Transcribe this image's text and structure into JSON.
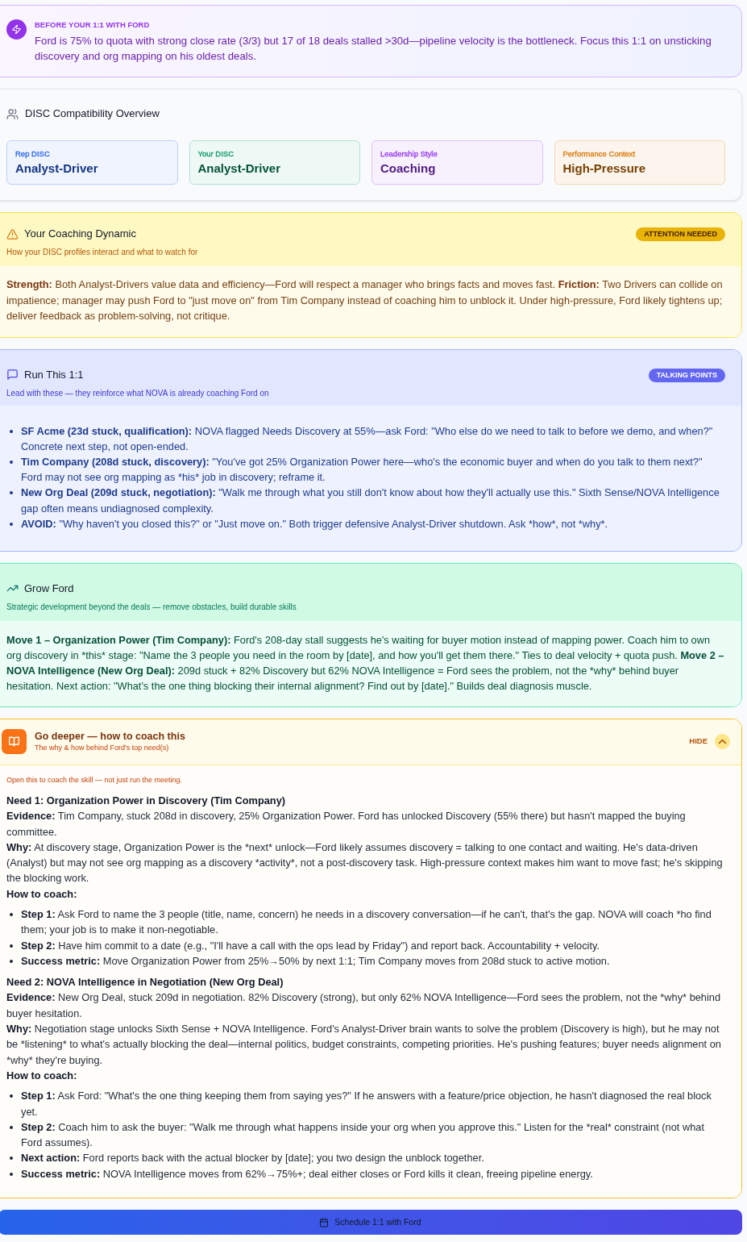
{
  "briefing": {
    "label": "BEFORE YOUR 1:1 WITH FORD",
    "text": "Ford is 75% to quota with strong close rate (3/3) but 17 of 18 deals stalled >30d—pipeline velocity is the bottleneck. Focus this 1:1 on unsticking discovery and org mapping on his oldest deals."
  },
  "disc_overview": {
    "title": "DISC Compatibility Overview",
    "tiles": [
      {
        "label": "Rep DISC",
        "value": "Analyst-Driver",
        "color": "#2563eb"
      },
      {
        "label": "Your DISC",
        "value": "Analyst-Driver",
        "color": "#059669"
      },
      {
        "label": "Leadership Style",
        "value": "Coaching",
        "color": "#9333ea"
      },
      {
        "label": "Performance Context",
        "value": "High-Pressure",
        "color": "#d97706"
      }
    ]
  },
  "coaching_dynamic": {
    "title": "Your Coaching Dynamic",
    "subtitle": "How your DISC profiles interact and what to watch for",
    "badge": "ATTENTION NEEDED",
    "body": "**Strength:** Both Analyst-Drivers value data and efficiency—Ford will respect a manager who brings facts and moves fast. **Friction:** Two Drivers can collide on impatience; manager may push Ford to \"just move on\" from Tim Company instead of coaching him to unblock it. Under high-pressure, Ford likely tightens up; deliver feedback as problem-solving, not critique."
  },
  "run_this": {
    "title": "Run This 1:1",
    "subtitle": "Lead with these — they reinforce what NOVA is already coaching Ford on",
    "badge": "TALKING POINTS",
    "points": [
      {
        "label": "SF Acme (23d stuck, qualification):",
        "text": "NOVA flagged Needs Discovery at 55%—ask Ford: \"Who else do we need to talk to before we demo, and when?\" Concrete next step, not open-ended."
      },
      {
        "label": "Tim Company (208d stuck, discovery):",
        "text": "\"You've got 25% Organization Power here—who's the economic buyer and when do you talk to them next?\" Ford may not see org mapping as *his* job in discovery; reframe it."
      },
      {
        "label": "New Org Deal (209d stuck, negotiation):",
        "text": "\"Walk me through what you still don't know about how they'll actually use this.\" Sixth Sense/NOVA Intelligence gap often means undiagnosed complexity."
      },
      {
        "label": "AVOID:",
        "text": "\"Why haven't you closed this?\" or \"Just move on.\" Both trigger defensive Analyst-Driver shutdown. Ask *how*, not *why*."
      }
    ]
  },
  "grow": {
    "title": "Grow Ford",
    "subtitle": "Strategic development beyond the deals — remove obstacles, build durable skills",
    "moves": [
      {
        "label": "Move 1 – Organization Power (Tim Company):",
        "text": "Ford's 208-day stall suggests he's waiting for buyer motion instead of mapping power. Coach him to own org discovery in *this* stage: \"Name the 3 people you need in the room by [date], and how you'll get them there.\" Ties to deal velocity + quota push."
      },
      {
        "label": "Move 2 – NOVA Intelligence (New Org Deal):",
        "text": "209d stuck + 82% Discovery but 62% NOVA Intelligence = Ford sees the problem, not the *why* behind buyer hesitation. Next action: \"What's the one thing blocking their internal alignment? Find out by [date].\" Builds deal diagnosis muscle."
      }
    ]
  },
  "go_deeper": {
    "title": "Go deeper — how to coach this",
    "subtitle": "The why & how behind Ford's top need(s)",
    "toggle": "HIDE",
    "expanded": true,
    "note": "Open this to coach the skill — not just run the meeting.",
    "needs": [
      {
        "title": "Need 1: Organization Power in Discovery (Tim Company)",
        "details": [
          {
            "label": "Evidence:",
            "text": "Tim Company, stuck 208d in discovery, 25% Organization Power. Ford has unlocked Discovery (55% there) but hasn't mapped the buying committee."
          },
          {
            "label": "Why:",
            "text": "At discovery stage, Organization Power is the *next* unlock—Ford likely assumes discovery = talking to one contact and waiting. He's data-driven (Analyst) but may not see org mapping as a discovery *activity*, not a post-discovery task. High-pressure context makes him want to move fast; he's skipping the blocking work."
          }
        ],
        "how_label": "How to coach:",
        "steps": [
          {
            "label": "Step 1:",
            "text": "Ask Ford to name the 3 people (title, name, concern) he needs in a discovery conversation—if he can't, that's the gap. NOVA will coach *ho find them; your job is to make it non-negotiable."
          },
          {
            "label": "Step 2:",
            "text": "Have him commit to a date (e.g., \"I'll have a call with the ops lead by Friday\") and report back. Accountability + velocity."
          },
          {
            "label": "Success metric:",
            "text": "Move Organization Power from 25%→50% by next 1:1; Tim Company moves from 208d stuck to active motion."
          }
        ]
      },
      {
        "title": "Need 2: NOVA Intelligence in Negotiation (New Org Deal)",
        "details": [
          {
            "label": "Evidence:",
            "text": "New Org Deal, stuck 209d in negotiation. 82% Discovery (strong), but only 62% NOVA Intelligence—Ford sees the problem, not the *why* behind buyer hesitation."
          },
          {
            "label": "Why:",
            "text": "Negotiation stage unlocks Sixth Sense + NOVA Intelligence. Ford's Analyst-Driver brain wants to solve the problem (Discovery is high), but he may not be *listening* to what's actually blocking the deal—internal politics, budget constraints, competing priorities. He's pushing features; buyer needs alignment on *why* they're buying."
          }
        ],
        "how_label": "How to coach:",
        "steps": [
          {
            "label": "Step 1:",
            "text": "Ask Ford: \"What's the one thing keeping them from saying yes?\" If he answers with a feature/price objection, he hasn't diagnosed the real block yet."
          },
          {
            "label": "Step 2:",
            "text": "Coach him to ask the buyer: \"Walk me through what happens inside your org when you approve this.\" Listen for the *real* constraint (not what Ford assumes)."
          },
          {
            "label": "Next action:",
            "text": "Ford reports back with the actual blocker by [date]; you two design the unblock together."
          },
          {
            "label": "Success metric:",
            "text": "NOVA Intelligence moves from 62%→75%+; deal either closes or Ford kills it clean, freeing pipeline energy."
          }
        ]
      }
    ]
  },
  "schedule_button": {
    "label": "Schedule 1:1 with Ford"
  }
}
